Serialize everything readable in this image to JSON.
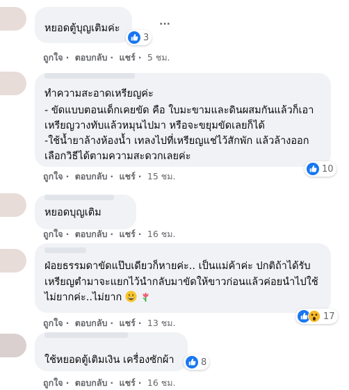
{
  "comments": [
    {
      "text": "หยอดตู้บุญเติมค่ะ",
      "reactions": 3,
      "time": "5 ชม."
    },
    {
      "title": "ทำความสะอาดเหรียญค่ะ",
      "lines": [
        "- ขัดแบบตอนเด็กเคยขัด คือ ใบมะขามและดินผสมกันแล้วก็เอา",
        "เหรียญวางทับแล้วหมุนไปมา หรือจะขยุมขัดเลยก็ได้",
        "-ใช้น้ำยาล้างห้องน้ำ เทลงไปที่เหรียญแช่ไว้สักพัก แล้วล้างออก",
        "เลือกวิธีได้ตามความสะดวกเลยค่ะ"
      ],
      "reactions": 10,
      "time": "15 ชม."
    },
    {
      "text": "หยอดบุญเติม",
      "time": "16 ชม."
    },
    {
      "lines": [
        "ฝ่อยธรรมดาขัดแป๊บเดียวก็หายค่ะ.. เป็นแม่ค้าค่ะ ปกติถ้าได้รับ",
        "เหรียญตำมาจะแยกไว้นำกลับมาขัดให้ขาวก่อนแล้วค่อยนำไปใช้",
        "ไม่ยากค่ะ..ไม่ยาก"
      ],
      "reactions": 17,
      "time": "13 ชม."
    },
    {
      "text": "ใช้หยอดตู้เติมเงิน เครื่องซักผ้า",
      "reactions": 8,
      "time": "16 ชม."
    }
  ],
  "actions": {
    "like": "ถูกใจ",
    "reply": "ตอบกลับ",
    "share": "แชร์",
    "sep": "·"
  },
  "more_menu": "···",
  "colors": {
    "like_blue": "#1877f2",
    "wow_yellow": "#f7b928",
    "bubble": "#f0f2f5",
    "meta": "#65676b"
  }
}
